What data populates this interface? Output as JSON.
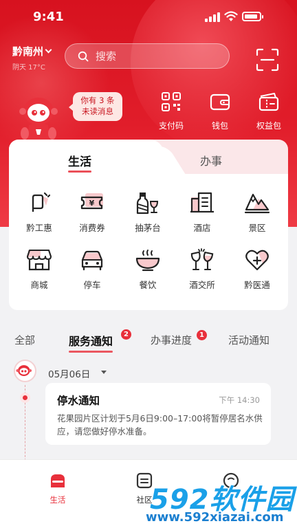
{
  "status_bar": {
    "time": "9:41"
  },
  "location": {
    "city": "黔南州",
    "weather": "阴天 17°C"
  },
  "search": {
    "placeholder": "搜索"
  },
  "bubble": {
    "line1": "你有 3 条",
    "line2": "未读消息"
  },
  "quick_actions": [
    {
      "label": "支付码",
      "icon": "qr-code-icon"
    },
    {
      "label": "钱包",
      "icon": "wallet-icon"
    },
    {
      "label": "权益包",
      "icon": "ticket-bag-icon"
    }
  ],
  "service_tabs": {
    "active": "生活",
    "inactive": "办事"
  },
  "services": [
    {
      "label": "黔工惠",
      "icon": "flag-icon"
    },
    {
      "label": "消费券",
      "icon": "coupon-icon"
    },
    {
      "label": "抽茅台",
      "icon": "bottle-icon"
    },
    {
      "label": "酒店",
      "icon": "hotel-icon"
    },
    {
      "label": "景区",
      "icon": "mountain-icon"
    },
    {
      "label": "商城",
      "icon": "shop-icon"
    },
    {
      "label": "停车",
      "icon": "car-icon"
    },
    {
      "label": "餐饮",
      "icon": "bowl-icon"
    },
    {
      "label": "酒交所",
      "icon": "wine-glass-icon"
    },
    {
      "label": "黔医通",
      "icon": "heart-plus-icon"
    }
  ],
  "notice_tabs": [
    {
      "label": "全部",
      "badge": ""
    },
    {
      "label": "服务通知",
      "badge": "2"
    },
    {
      "label": "办事进度",
      "badge": "1"
    },
    {
      "label": "活动通知",
      "badge": ""
    }
  ],
  "timeline": {
    "date": "05月06日",
    "notice": {
      "title": "停水通知",
      "time": "下午 14:30",
      "text": "花果园片区计划于5月6日9:00–17:00将暂停居名水供应，请您做好停水准备。"
    }
  },
  "bottom_nav": [
    {
      "label": "生活"
    },
    {
      "label": "社区"
    }
  ],
  "watermark": {
    "big": "592软件园",
    "small": "www.592xiazai.com"
  },
  "colors": {
    "brand_red": "#e11d2a",
    "accent": "#e8303b",
    "watermark_blue": "#1aa0e8"
  }
}
